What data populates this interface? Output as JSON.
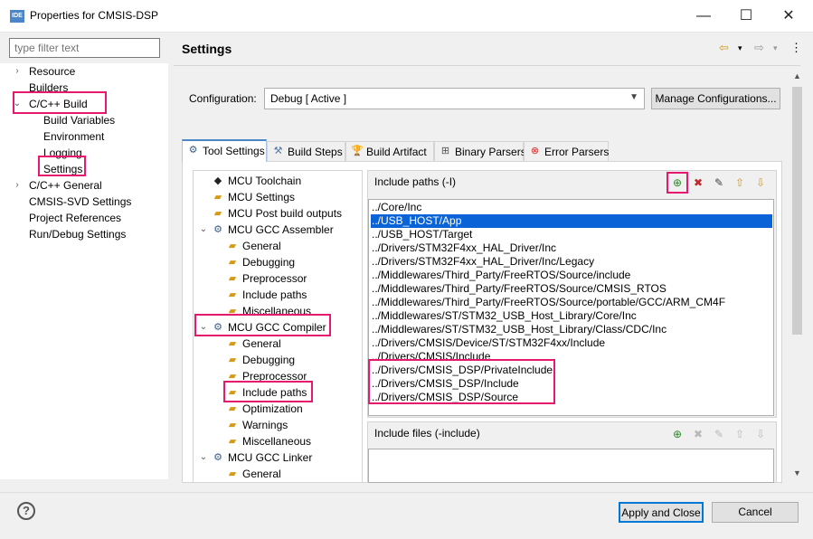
{
  "window": {
    "app_badge": "IDE",
    "title": "Properties for CMSIS-DSP",
    "minimize_glyph": "—",
    "maximize_glyph": "☐",
    "close_glyph": "✕"
  },
  "filter": {
    "placeholder": "type filter text"
  },
  "nav_tree": [
    {
      "label": "Resource",
      "caret": "›"
    },
    {
      "label": "Builders",
      "caret": ""
    },
    {
      "label": "C/C++ Build",
      "caret": "⌄"
    },
    {
      "label": "Build Variables",
      "caret": ""
    },
    {
      "label": "Environment",
      "caret": ""
    },
    {
      "label": "Logging",
      "caret": ""
    },
    {
      "label": "Settings",
      "caret": ""
    },
    {
      "label": "C/C++ General",
      "caret": "›"
    },
    {
      "label": "CMSIS-SVD Settings",
      "caret": ""
    },
    {
      "label": "Project References",
      "caret": ""
    },
    {
      "label": "Run/Debug Settings",
      "caret": ""
    }
  ],
  "page": {
    "title": "Settings",
    "back_icon": "⇦",
    "forward_icon": "⇨",
    "dropdown_glyph": "▾",
    "menu_glyph": "⋮"
  },
  "configuration": {
    "label": "Configuration:",
    "value": "Debug  [ Active ]",
    "manage_label": "Manage Configurations..."
  },
  "tabs": [
    {
      "label": "Tool Settings",
      "icon": "gear-icon",
      "active": true
    },
    {
      "label": "Build Steps",
      "icon": "build-steps-icon",
      "active": false
    },
    {
      "label": "Build Artifact",
      "icon": "trophy-icon",
      "active": false
    },
    {
      "label": "Binary Parsers",
      "icon": "binary-icon",
      "active": false
    },
    {
      "label": "Error Parsers",
      "icon": "error-icon",
      "active": false
    }
  ],
  "tool_tree": [
    {
      "label": "MCU Toolchain",
      "icon": "chip-icon",
      "level": 0,
      "caret": ""
    },
    {
      "label": "MCU Settings",
      "icon": "folder-icon",
      "level": 0,
      "caret": ""
    },
    {
      "label": "MCU Post build outputs",
      "icon": "folder-icon",
      "level": 0,
      "caret": ""
    },
    {
      "label": "MCU GCC Assembler",
      "icon": "gear-icon",
      "level": 0,
      "caret": "⌄"
    },
    {
      "label": "General",
      "icon": "folder-icon",
      "level": 1,
      "caret": ""
    },
    {
      "label": "Debugging",
      "icon": "folder-icon",
      "level": 1,
      "caret": ""
    },
    {
      "label": "Preprocessor",
      "icon": "folder-icon",
      "level": 1,
      "caret": ""
    },
    {
      "label": "Include paths",
      "icon": "folder-icon",
      "level": 1,
      "caret": ""
    },
    {
      "label": "Miscellaneous",
      "icon": "folder-icon",
      "level": 1,
      "caret": ""
    },
    {
      "label": "MCU GCC Compiler",
      "icon": "gear-icon",
      "level": 0,
      "caret": "⌄"
    },
    {
      "label": "General",
      "icon": "folder-icon",
      "level": 1,
      "caret": ""
    },
    {
      "label": "Debugging",
      "icon": "folder-icon",
      "level": 1,
      "caret": ""
    },
    {
      "label": "Preprocessor",
      "icon": "folder-icon",
      "level": 1,
      "caret": ""
    },
    {
      "label": "Include paths",
      "icon": "folder-icon",
      "level": 1,
      "caret": ""
    },
    {
      "label": "Optimization",
      "icon": "folder-icon",
      "level": 1,
      "caret": ""
    },
    {
      "label": "Warnings",
      "icon": "folder-icon",
      "level": 1,
      "caret": ""
    },
    {
      "label": "Miscellaneous",
      "icon": "folder-icon",
      "level": 1,
      "caret": ""
    },
    {
      "label": "MCU GCC Linker",
      "icon": "gear-icon",
      "level": 0,
      "caret": "⌄"
    },
    {
      "label": "General",
      "icon": "folder-icon",
      "level": 1,
      "caret": ""
    }
  ],
  "include_paths": {
    "title": "Include paths (-I)",
    "selected_index": 1,
    "items": [
      "../Core/Inc",
      "../USB_HOST/App",
      "../USB_HOST/Target",
      "../Drivers/STM32F4xx_HAL_Driver/Inc",
      "../Drivers/STM32F4xx_HAL_Driver/Inc/Legacy",
      "../Middlewares/Third_Party/FreeRTOS/Source/include",
      "../Middlewares/Third_Party/FreeRTOS/Source/CMSIS_RTOS",
      "../Middlewares/Third_Party/FreeRTOS/Source/portable/GCC/ARM_CM4F",
      "../Middlewares/ST/STM32_USB_Host_Library/Core/Inc",
      "../Middlewares/ST/STM32_USB_Host_Library/Class/CDC/Inc",
      "../Drivers/CMSIS/Device/ST/STM32F4xx/Include",
      "../Drivers/CMSIS/Include",
      "../Drivers/CMSIS_DSP/PrivateInclude",
      "../Drivers/CMSIS_DSP/Include",
      "../Drivers/CMSIS_DSP/Source"
    ]
  },
  "include_files": {
    "title": "Include files (-include)",
    "items": []
  },
  "toolbar_icons": [
    "add-icon",
    "delete-icon",
    "edit-icon",
    "move-up-icon",
    "move-down-icon"
  ],
  "buttons": {
    "help": "?",
    "apply_close": "Apply and Close",
    "cancel": "Cancel"
  },
  "colors": {
    "highlight": "#e6196e",
    "selection": "#0a64d8",
    "accent": "#0078d7"
  }
}
